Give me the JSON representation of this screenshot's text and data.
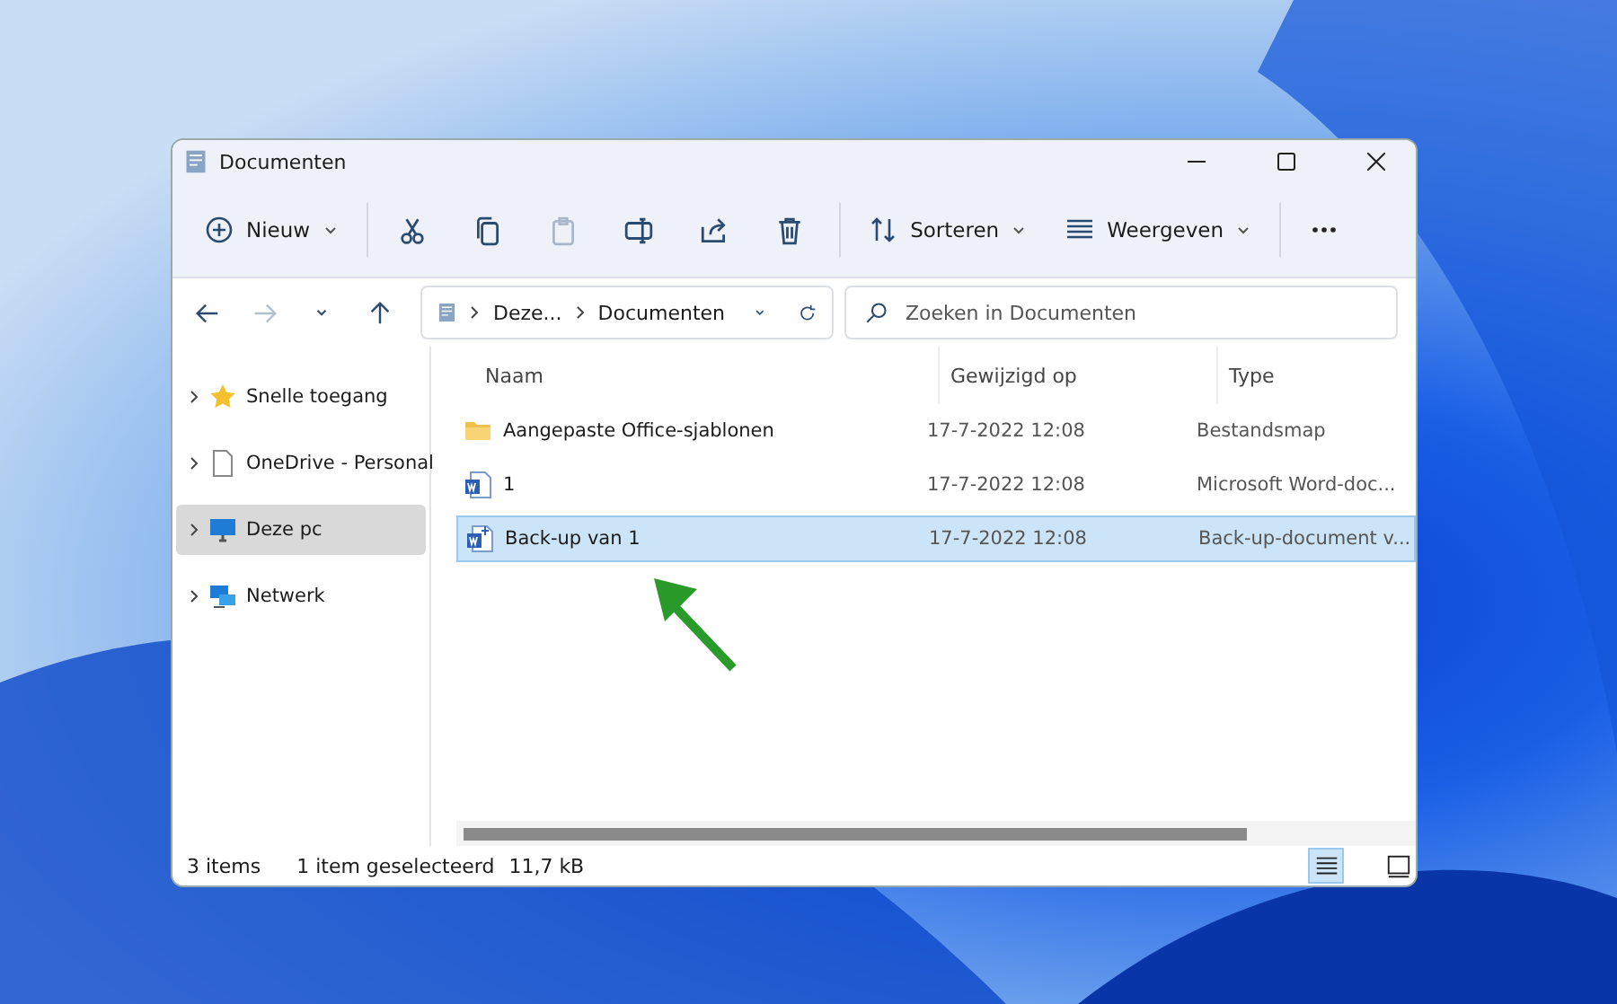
{
  "window": {
    "title": "Documenten"
  },
  "toolbar": [
    {
      "kind": "menu",
      "label": "Nieuw",
      "disabled": false
    },
    {
      "kind": "icon",
      "disabled": false
    },
    {
      "kind": "icon",
      "disabled": false
    },
    {
      "kind": "icon",
      "disabled": true
    },
    {
      "kind": "icon",
      "disabled": false
    },
    {
      "kind": "icon",
      "disabled": false
    },
    {
      "kind": "icon",
      "disabled": false
    },
    {
      "kind": "menu",
      "label": "Sorteren",
      "disabled": false
    },
    {
      "kind": "menu",
      "label": "Weergeven",
      "disabled": false
    },
    {
      "kind": "more",
      "disabled": false
    }
  ],
  "navigation": [
    {
      "disabled": false
    },
    {
      "disabled": true
    },
    {
      "disabled": false
    },
    {
      "disabled": false
    }
  ],
  "address": {
    "crumbs": [
      "Deze...",
      "Documenten"
    ]
  },
  "search": {
    "placeholder": "Zoeken in Documenten"
  },
  "sidebar": {
    "items": [
      {
        "label": "Snelle toegang",
        "selected": false
      },
      {
        "label": "OneDrive - Personal",
        "selected": false
      },
      {
        "label": "Deze pc",
        "selected": true
      },
      {
        "label": "Netwerk",
        "selected": false
      }
    ]
  },
  "table": {
    "columns": [
      "Naam",
      "Gewijzigd op",
      "Type"
    ],
    "rows": [
      {
        "kind": "folder",
        "name": "Aangepaste Office-sjablonen",
        "modified": "17-7-2022 12:08",
        "type": "Bestandsmap",
        "selected": false
      },
      {
        "kind": "word",
        "name": "1",
        "modified": "17-7-2022 12:08",
        "type": "Microsoft Word-doc...",
        "selected": false
      },
      {
        "kind": "backup",
        "name": "Back-up van 1",
        "modified": "17-7-2022 12:08",
        "type": "Back-up-document v...",
        "selected": true
      }
    ]
  },
  "status_bar": {
    "items": [
      "3 items",
      "1 item geselecteerd",
      "11,7 kB"
    ],
    "views": [
      {
        "selected": true
      },
      {
        "selected": false
      }
    ]
  }
}
